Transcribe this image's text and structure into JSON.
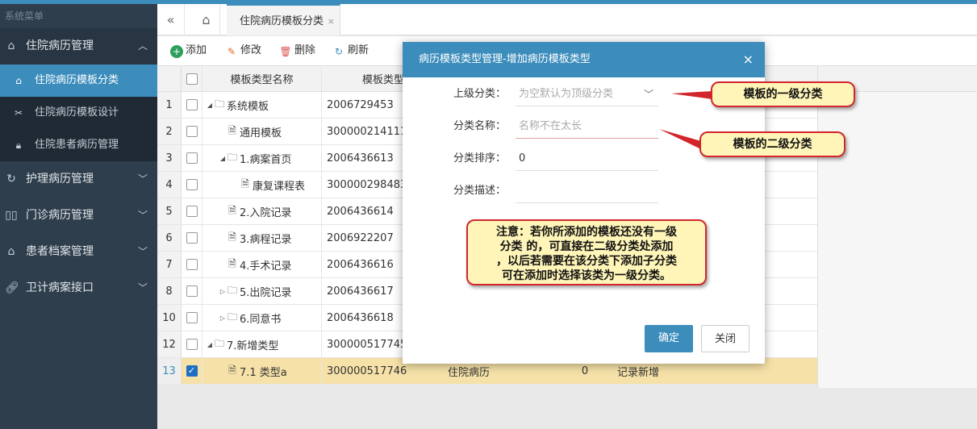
{
  "colors": {
    "accent": "#3c8dbc",
    "sidebar_bg": "#2f3e4d",
    "selected_row": "#f6e2a8",
    "callout_bg": "#fff5b8",
    "callout_border": "#d2262c"
  },
  "sidebar": {
    "system_label": "系统菜单",
    "groups": [
      {
        "label": "住院病历管理",
        "icon": "home-icon",
        "open": true,
        "items": [
          {
            "label": "住院病历模板分类",
            "icon": "home-icon",
            "active": true
          },
          {
            "label": "住院病历模板设计",
            "icon": "tools-icon",
            "active": false
          },
          {
            "label": "住院患者病历管理",
            "icon": "lock-icon",
            "active": false
          }
        ]
      },
      {
        "label": "护理病历管理",
        "icon": "refresh-icon"
      },
      {
        "label": "门诊病历管理",
        "icon": "book-icon"
      },
      {
        "label": "患者档案管理",
        "icon": "home-icon"
      },
      {
        "label": "卫计病案接口",
        "icon": "link-icon"
      }
    ]
  },
  "tabs": {
    "active_label": "住院病历模板分类",
    "close_symbol": "×"
  },
  "toolbar": {
    "add": "添加",
    "edit": "修改",
    "delete": "删除",
    "refresh": "刷新"
  },
  "table": {
    "headers": {
      "name": "模板类型名称",
      "code": "模板类型"
    },
    "rows": [
      {
        "num": "1",
        "level": 0,
        "expanded": true,
        "type": "folder",
        "name": "系统模板",
        "code": "2006729453",
        "checked": false
      },
      {
        "num": "2",
        "level": 1,
        "expanded": null,
        "type": "file",
        "name": "通用模板",
        "code": "300000214111",
        "checked": false
      },
      {
        "num": "3",
        "level": 1,
        "expanded": true,
        "type": "folder",
        "name": "1.病案首页",
        "code": "2006436613",
        "checked": false
      },
      {
        "num": "4",
        "level": 2,
        "expanded": null,
        "type": "file",
        "name": "康复课程表",
        "code": "300000298483",
        "checked": false
      },
      {
        "num": "5",
        "level": 1,
        "expanded": null,
        "type": "file",
        "name": "2.入院记录",
        "code": "2006436614",
        "checked": false
      },
      {
        "num": "6",
        "level": 1,
        "expanded": null,
        "type": "file",
        "name": "3.病程记录",
        "code": "2006922207",
        "checked": false
      },
      {
        "num": "7",
        "level": 1,
        "expanded": null,
        "type": "file",
        "name": "4.手术记录",
        "code": "2006436616",
        "checked": false
      },
      {
        "num": "8",
        "level": 1,
        "expanded": false,
        "type": "folder",
        "name": "5.出院记录",
        "code": "2006436617",
        "checked": false
      },
      {
        "num": "10",
        "level": 1,
        "expanded": false,
        "type": "folder",
        "name": "6.同意书",
        "code": "2006436618",
        "checked": false
      },
      {
        "num": "12",
        "level": 0,
        "expanded": true,
        "type": "folder",
        "name": "7.新增类型",
        "code": "300000517745",
        "checked": false
      },
      {
        "num": "13",
        "level": 1,
        "expanded": null,
        "type": "file",
        "name": "7.1 类型a",
        "code": "300000517746",
        "category": "住院病历",
        "sort": "0",
        "desc": "记录新增",
        "checked": true,
        "selected": true
      }
    ]
  },
  "modal": {
    "title": "病历模板类型管理-增加病历模板类型",
    "close_symbol": "×",
    "fields": {
      "parent_label": "上级分类：",
      "parent_placeholder": "为空默认为顶级分类",
      "name_label": "分类名称：",
      "name_placeholder": "名称不在太长",
      "sort_label": "分类排序：",
      "sort_value": "0",
      "desc_label": "分类描述：",
      "desc_value": ""
    },
    "ok_label": "确定",
    "close_label": "关闭"
  },
  "callouts": {
    "first": "模板的一级分类",
    "second": "模板的二级分类",
    "note_line1": "注意：若你所添加的模板还没有一级",
    "note_line2": "分类 的，可直接在二级分类处添加",
    "note_line3": "，以后若需要在该分类下添加子分类",
    "note_line4": "可在添加时选择该类为一级分类。"
  }
}
